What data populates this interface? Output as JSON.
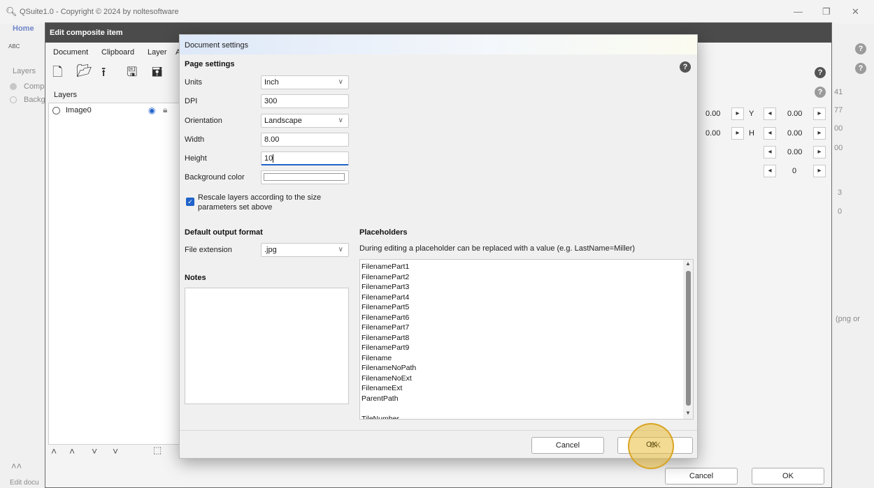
{
  "app": {
    "title": "QSuite1.0 - Copyright © 2024 by noltesoftware",
    "home_tab": "Home"
  },
  "background": {
    "layers_label": "Layers",
    "items": [
      "Comp",
      "Backg"
    ],
    "bottom_label": "Edit docu",
    "right_partial": [
      "41",
      "77",
      "00",
      "00",
      "3",
      "0"
    ],
    "png_hint": "(png or"
  },
  "composite": {
    "title": "Edit composite item",
    "tabs": [
      "Document",
      "Clipboard",
      "Layer",
      "A"
    ],
    "layers_tab": "Layers",
    "layer_items": [
      "Image0"
    ],
    "cancel": "Cancel",
    "ok": "OK",
    "props": {
      "x_val": "0.00",
      "y_label": "Y",
      "y_val": "0.00",
      "w_val": "0.00",
      "h_label": "H",
      "h_val": "0.00",
      "r3_val": "0.00",
      "r4_val": "0"
    }
  },
  "dialog": {
    "title": "Document settings",
    "page_settings": "Page settings",
    "units_label": "Units",
    "units_value": "Inch",
    "dpi_label": "DPI",
    "dpi_value": "300",
    "orientation_label": "Orientation",
    "orientation_value": "Landscape",
    "width_label": "Width",
    "width_value": "8.00",
    "height_label": "Height",
    "height_value": "10",
    "bgcolor_label": "Background color",
    "rescale_line1": "Rescale layers according to the size",
    "rescale_line2": "parameters set above",
    "output_format": "Default output format",
    "file_ext_label": "File extension",
    "file_ext_value": ".jpg",
    "notes": "Notes",
    "placeholders": "Placeholders",
    "placeholders_desc": "During editing a placeholder can be replaced with a value (e.g. LastName=Miller)",
    "placeholder_items": [
      "FilenamePart1",
      "FilenamePart2",
      "FilenamePart3",
      "FilenamePart4",
      "FilenamePart5",
      "FilenamePart6",
      "FilenamePart7",
      "FilenamePart8",
      "FilenamePart9",
      "Filename",
      "FilenameNoPath",
      "FilenameNoExt",
      "FilenameExt",
      "ParentPath",
      "",
      "TileNumber"
    ],
    "cancel": "Cancel",
    "ok": "OK"
  },
  "icons": {
    "help": "?"
  },
  "colors": {
    "accent": "#1f62c9",
    "highlight": "#ebbe3c",
    "dialog_title": "#4b4b4b"
  }
}
